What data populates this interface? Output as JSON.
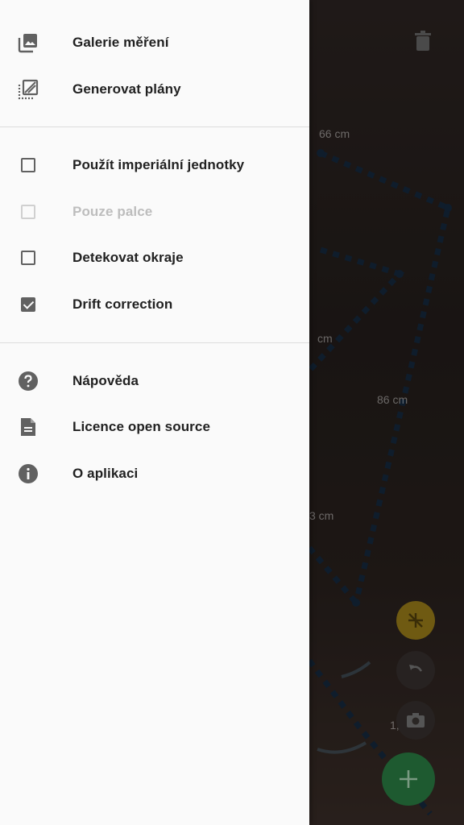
{
  "drawer": {
    "top_items": [
      {
        "label": "Galerie měření",
        "icon": "gallery-icon"
      },
      {
        "label": "Generovat plány",
        "icon": "floorplan-icon"
      }
    ],
    "settings": [
      {
        "label": "Použít imperiální jednotky",
        "checked": false,
        "enabled": true
      },
      {
        "label": "Pouze palce",
        "checked": false,
        "enabled": false
      },
      {
        "label": "Detekovat okraje",
        "checked": false,
        "enabled": true
      },
      {
        "label": "Drift correction",
        "checked": true,
        "enabled": true
      }
    ],
    "info_items": [
      {
        "label": "Nápověda",
        "icon": "help-icon"
      },
      {
        "label": "Licence open source",
        "icon": "document-icon"
      },
      {
        "label": "O aplikaci",
        "icon": "info-icon"
      }
    ]
  },
  "camera": {
    "measure_labels": [
      "66 cm",
      "cm",
      "86 cm",
      "3 cm",
      "1,"
    ]
  },
  "colors": {
    "icon_gray": "#616161",
    "text": "#212121",
    "disabled": "#bdbdbd",
    "fab_green": "#1e5a30",
    "fab_yellow": "#6f5a12"
  }
}
